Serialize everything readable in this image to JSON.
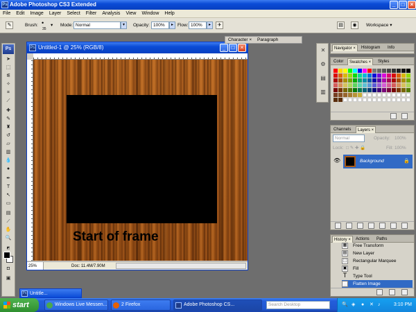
{
  "app": {
    "title": "Adobe Photoshop CS3 Extended",
    "icon": "ps-icon"
  },
  "menu": [
    "File",
    "Edit",
    "Image",
    "Layer",
    "Select",
    "Filter",
    "Analysis",
    "View",
    "Window",
    "Help"
  ],
  "options_bar": {
    "brush_label": "Brush:",
    "brush_size": "35",
    "mode_label": "Mode:",
    "mode_value": "Normal",
    "opacity_label": "Opacity:",
    "opacity_value": "100%",
    "flow_label": "Flow:",
    "flow_value": "100%",
    "workspace_label": "Workspace ▾"
  },
  "document": {
    "title": "Untitled-1 @ 25% (RGB/8)",
    "zoom": "25%",
    "doc_info": "Doc: 11.4M/7.90M",
    "canvas_text": "Start of frame",
    "wood_color": "#a85a18",
    "frame_color": "#000000"
  },
  "floating_tabs": {
    "character": "Character ×",
    "paragraph": "Paragraph"
  },
  "panels": {
    "navigator_tabs": [
      "Navigator ×",
      "Histogram",
      "Info"
    ],
    "swatches_tabs": [
      "Color",
      "Swatches ×",
      "Styles"
    ],
    "layers_tabs": [
      "Channels",
      "Layers ×"
    ],
    "layers": {
      "blend_mode": "Normal",
      "opacity_label": "Opacity:",
      "opacity": "100%",
      "lock_label": "Lock:",
      "fill_label": "Fill:",
      "fill": "100%",
      "layer_name": "Background"
    },
    "history_tabs": [
      "History ×",
      "Actions",
      "Paths"
    ],
    "history_items": [
      "Free Transform",
      "New Layer",
      "Rectangular Marquee",
      "Fill",
      "Type Tool",
      "Flatten Image"
    ],
    "history_active": "Flatten Image"
  },
  "minimized_window": {
    "title": "Untitle..."
  },
  "taskbar": {
    "start_label": "start",
    "tasks": [
      "Windows Live Messen...",
      "2 Firefox",
      "Adobe Photoshop CS..."
    ],
    "search_placeholder": "Search Desktop",
    "clock": "3:10 PM"
  }
}
